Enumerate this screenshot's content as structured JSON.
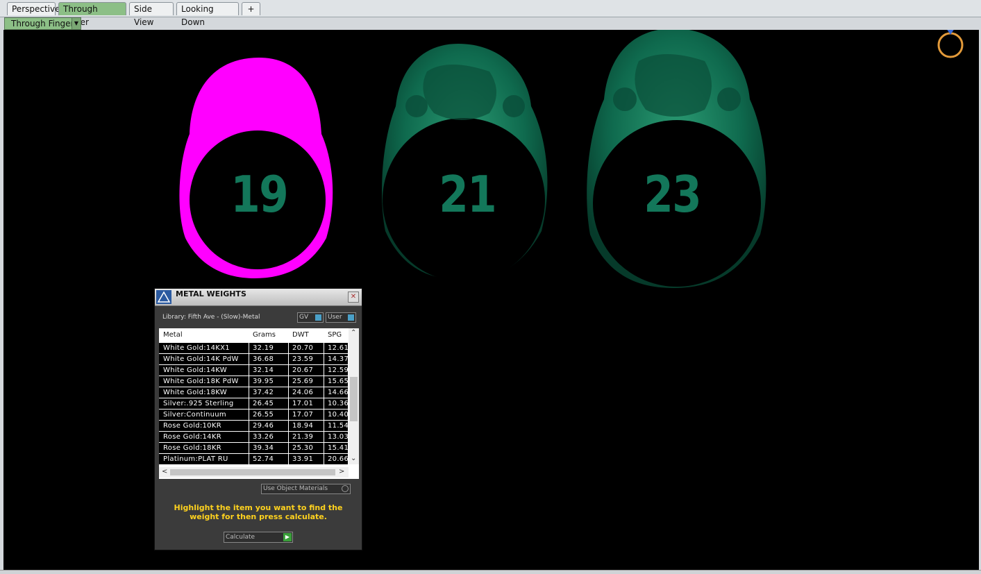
{
  "tabs": [
    {
      "label": "Perspective",
      "active": false
    },
    {
      "label": "Through Finger",
      "active": true
    },
    {
      "label": "Side View",
      "active": false
    },
    {
      "label": "Looking Down",
      "active": false
    }
  ],
  "add_tab_label": "+",
  "viewport_selector": {
    "label": "Through Finger"
  },
  "rings": [
    {
      "number": "19",
      "color": "#ff00ff"
    },
    {
      "number": "21",
      "color": "#0f6a4e"
    },
    {
      "number": "23",
      "color": "#0f6a4e"
    }
  ],
  "panel": {
    "title": "METAL WEIGHTS",
    "library": "Library: Fifth Ave - (Slow)-Metal",
    "toggle_gv": "GV",
    "toggle_user": "User",
    "columns": [
      "Metal",
      "Grams",
      "DWT",
      "SPG"
    ],
    "rows": [
      [
        "White Gold:14KX1",
        "32.19",
        "20.70",
        "12.61"
      ],
      [
        "White Gold:14K PdW",
        "36.68",
        "23.59",
        "14.37"
      ],
      [
        "White Gold:14KW",
        "32.14",
        "20.67",
        "12.59"
      ],
      [
        "White Gold:18K PdW",
        "39.95",
        "25.69",
        "15.65"
      ],
      [
        "White Gold:18KW",
        "37.42",
        "24.06",
        "14.66"
      ],
      [
        "Silver:.925 Sterling",
        "26.45",
        "17.01",
        "10.36"
      ],
      [
        "Silver:Continuum",
        "26.55",
        "17.07",
        "10.40"
      ],
      [
        "Rose Gold:10KR",
        "29.46",
        "18.94",
        "11.54"
      ],
      [
        "Rose Gold:14KR",
        "33.26",
        "21.39",
        "13.03"
      ],
      [
        "Rose Gold:18KR",
        "39.34",
        "25.30",
        "15.41"
      ],
      [
        "Platinum:PLAT RU",
        "52.74",
        "33.91",
        "20.66"
      ]
    ],
    "use_object_materials": "Use Object Materials",
    "hint": "Highlight the item you want to find the weight for then press calculate.",
    "calculate": "Calculate"
  }
}
